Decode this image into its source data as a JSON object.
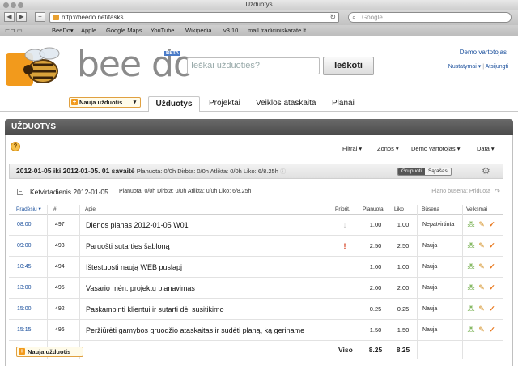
{
  "browser": {
    "window_title": "Užduotys",
    "url": "http://beedo.net/tasks",
    "search_placeholder": "Google",
    "bookmarks": [
      "BeeDo▾",
      "Apple",
      "Google Maps",
      "YouTube",
      "Wikipedia",
      "v3.10",
      "mail.tradiciniskarate.lt"
    ]
  },
  "header": {
    "logo_text": "bee do",
    "beta": "BETA",
    "search_placeholder": "Ieškai užduoties?",
    "search_button": "Ieškoti",
    "user_name": "Demo vartotojas",
    "settings_link": "Nustatymai ▾",
    "separator": "|",
    "logout_link": "Atsijungti"
  },
  "nav": {
    "new_task": "Nauja užduotis",
    "tabs": [
      "Užduotys",
      "Projektai",
      "Veiklos ataskaita",
      "Planai"
    ]
  },
  "panel": {
    "title": "UŽDUOTYS",
    "filters": [
      "Filtrai ▾",
      "Zonos ▾",
      "Demo vartotojas ▾",
      "Data ▾"
    ]
  },
  "week": {
    "range": "2012-01-05 iki 2012-01-05. 01 savaitė",
    "stats": "Planuota: 0/0h   Dirbta: 0/0h   Atlikta: 0/0h   Liko: 6/8.25h",
    "grouped": "Grupuoti",
    "list": "Sąrašas"
  },
  "day": {
    "toggle": "−",
    "title": "Ketvirtadienis 2012-01-05",
    "stats": "Planuota: 0/0h   Dirbta: 0/0h   Atlikta: 0/0h   Liko: 6/8.25h",
    "plan_state": "Plano būsena: Priduota"
  },
  "table": {
    "headers": {
      "start": "Pradėsiu ▾",
      "num": "#",
      "about": "Apie",
      "priority": "Priorit.",
      "planned": "Planuota",
      "left": "Liko",
      "status": "Būsena",
      "actions": "Veiksmai"
    },
    "rows": [
      {
        "time": "08:00",
        "num": "497",
        "title": "Dienos planas 2012-01-05 W01",
        "priority": "low",
        "planned": "1.00",
        "left": "1.00",
        "status": "Nepatvirtinta"
      },
      {
        "time": "09:00",
        "num": "493",
        "title": "Paruošti sutarties šabloną",
        "priority": "high",
        "planned": "2.50",
        "left": "2.50",
        "status": "Nauja"
      },
      {
        "time": "10:45",
        "num": "494",
        "title": "Ištestuosti naują WEB puslapį",
        "priority": "",
        "planned": "1.00",
        "left": "1.00",
        "status": "Nauja"
      },
      {
        "time": "13:00",
        "num": "495",
        "title": "Vasario mėn. projektų planavimas",
        "priority": "",
        "planned": "2.00",
        "left": "2.00",
        "status": "Nauja"
      },
      {
        "time": "15:00",
        "num": "492",
        "title": "Paskambinti klientui ir sutarti dėl susitikimo",
        "priority": "",
        "planned": "0.25",
        "left": "0.25",
        "status": "Nauja"
      },
      {
        "time": "15:15",
        "num": "496",
        "title": "Peržiūrėti gamybos gruodžio ataskaitas ir sudėti planą, ką geriname",
        "priority": "",
        "planned": "1.50",
        "left": "1.50",
        "status": "Nauja"
      }
    ],
    "footer": {
      "new_task": "Nauja užduotis",
      "total_label": "Viso",
      "total_planned": "8.25",
      "total_left": "8.25"
    }
  },
  "colors": {
    "accent": "#f29a1c",
    "link": "#1a4f9c",
    "panel_header": "#555555"
  }
}
